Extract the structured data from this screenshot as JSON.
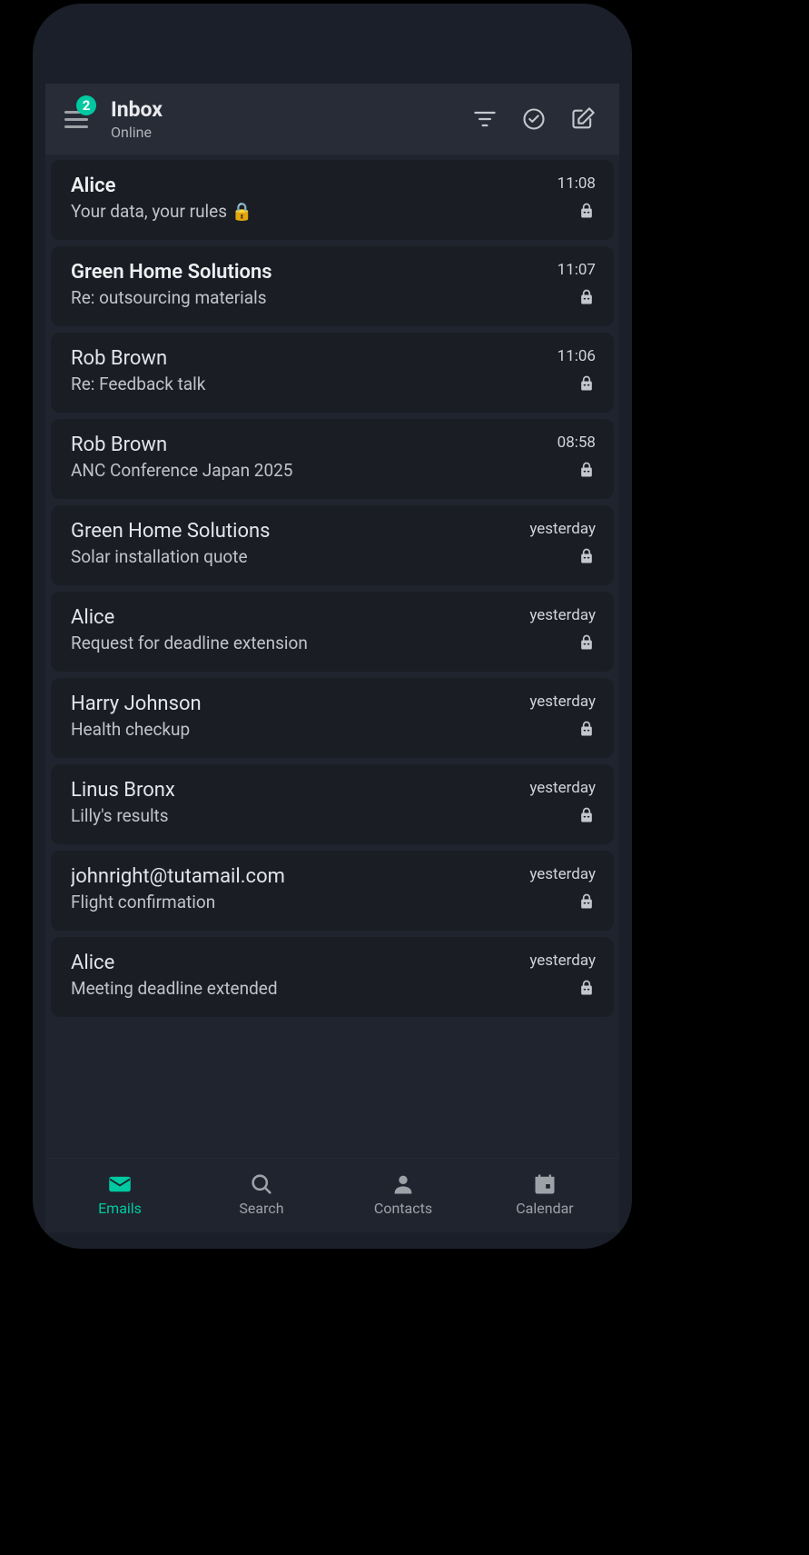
{
  "header": {
    "title": "Inbox",
    "status": "Online",
    "badge": "2"
  },
  "emails": [
    {
      "sender": "Alice",
      "subject": "Your data, your rules 🔒",
      "time": "11:08",
      "unread": true
    },
    {
      "sender": "Green Home Solutions",
      "subject": "Re: outsourcing materials",
      "time": "11:07",
      "unread": true
    },
    {
      "sender": "Rob Brown",
      "subject": "Re: Feedback talk",
      "time": "11:06",
      "unread": false
    },
    {
      "sender": "Rob Brown",
      "subject": "ANC Conference Japan 2025",
      "time": "08:58",
      "unread": false
    },
    {
      "sender": "Green Home Solutions",
      "subject": "Solar installation quote",
      "time": "yesterday",
      "unread": false
    },
    {
      "sender": "Alice",
      "subject": "Request for deadline extension",
      "time": "yesterday",
      "unread": false
    },
    {
      "sender": "Harry Johnson",
      "subject": "Health checkup",
      "time": "yesterday",
      "unread": false
    },
    {
      "sender": "Linus Bronx",
      "subject": "Lilly's results",
      "time": "yesterday",
      "unread": false
    },
    {
      "sender": "johnright@tutamail.com",
      "subject": "Flight confirmation",
      "time": "yesterday",
      "unread": false
    },
    {
      "sender": "Alice",
      "subject": "Meeting deadline extended",
      "time": "yesterday",
      "unread": false
    }
  ],
  "nav": {
    "emails": "Emails",
    "search": "Search",
    "contacts": "Contacts",
    "calendar": "Calendar"
  }
}
